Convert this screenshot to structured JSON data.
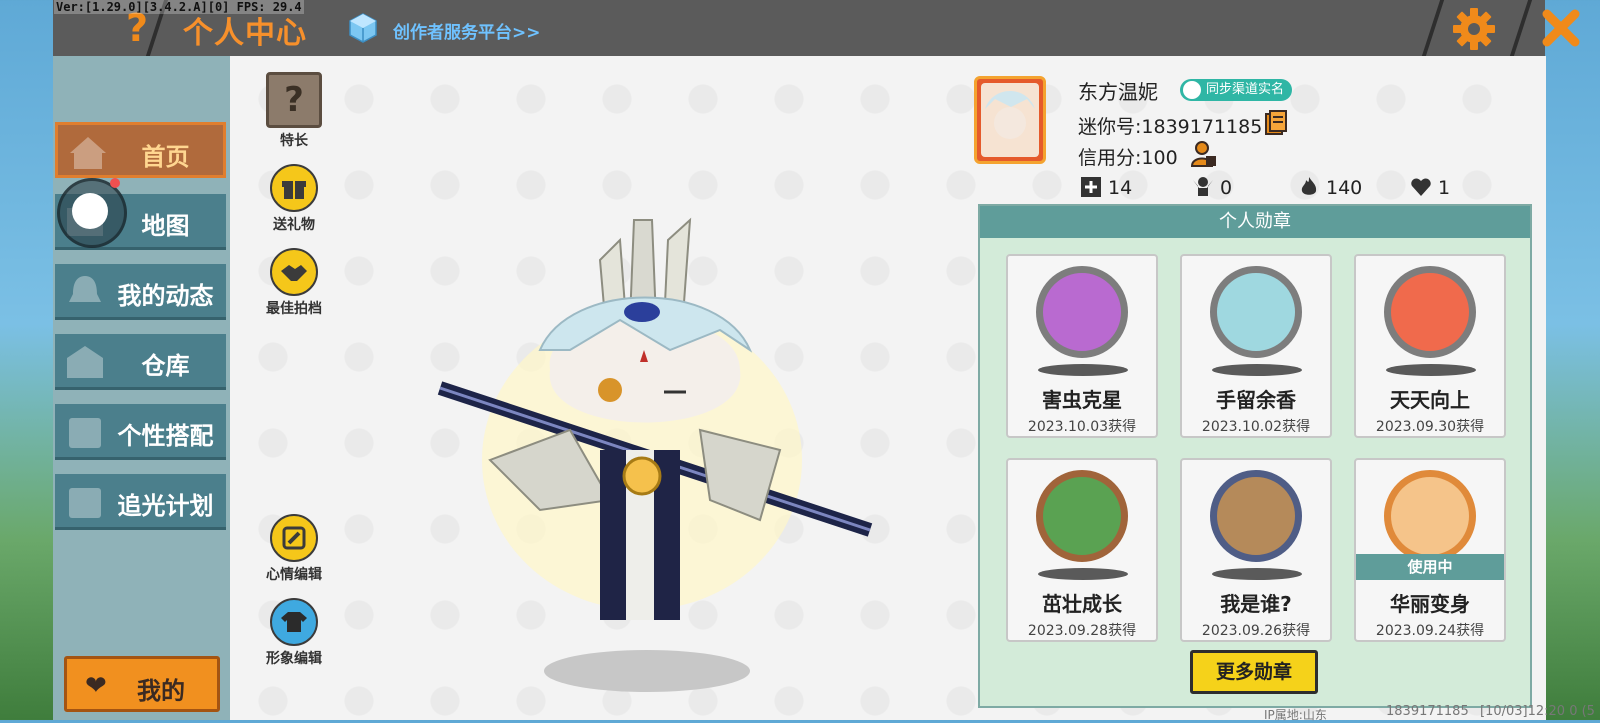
{
  "debug_text": "Ver:[1.29.0][3.4.2.A][0] FPS: 29.4",
  "header": {
    "title": "个人中心",
    "creator_link": "创作者服务平台>>",
    "help_icon": "question-icon",
    "settings_icon": "gear-icon",
    "close_icon": "close-icon"
  },
  "sidebar": {
    "items": [
      {
        "label": "首页",
        "icon": "home-icon"
      },
      {
        "label": "地图",
        "icon": "map-icon"
      },
      {
        "label": "我的动态",
        "icon": "bell-icon"
      },
      {
        "label": "仓库",
        "icon": "warehouse-icon"
      },
      {
        "label": "个性搭配",
        "icon": "outfit-icon"
      },
      {
        "label": "追光计划",
        "icon": "plan-icon"
      }
    ],
    "active_index": 0,
    "my_button": "我的"
  },
  "actions": {
    "skill": "特长",
    "gift": "送礼物",
    "partner": "最佳拍档",
    "mood": "心情编辑",
    "appearance": "形象编辑"
  },
  "profile": {
    "nickname": "东方温妮",
    "sync_badge": "同步渠道实名",
    "mini_id": "迷你号:1839171185",
    "credit": "信用分:100",
    "stats": {
      "friends": "14",
      "fans": "0",
      "popularity": "140",
      "likes": "1"
    }
  },
  "badges": {
    "title": "个人勋章",
    "items": [
      {
        "name": "害虫克星",
        "date": "2023.10.03获得",
        "in_use": false
      },
      {
        "name": "手留余香",
        "date": "2023.10.02获得",
        "in_use": false
      },
      {
        "name": "天天向上",
        "date": "2023.09.30获得",
        "in_use": false
      },
      {
        "name": "茁壮成长",
        "date": "2023.09.28获得",
        "in_use": false
      },
      {
        "name": "我是谁?",
        "date": "2023.09.26获得",
        "in_use": false
      },
      {
        "name": "华丽变身",
        "date": "2023.09.24获得",
        "in_use": true
      }
    ],
    "in_use_label": "使用中",
    "more_button": "更多勋章"
  },
  "footer": {
    "ip": "IP属地:山东",
    "id": "1839171185",
    "time": "[10/03]12:20 0 (5"
  },
  "colors": {
    "accent_orange": "#f7902b",
    "badge_header": "#5f9d9a",
    "nav_teal": "#4b7f8c",
    "gold_button": "#f5d21a"
  }
}
